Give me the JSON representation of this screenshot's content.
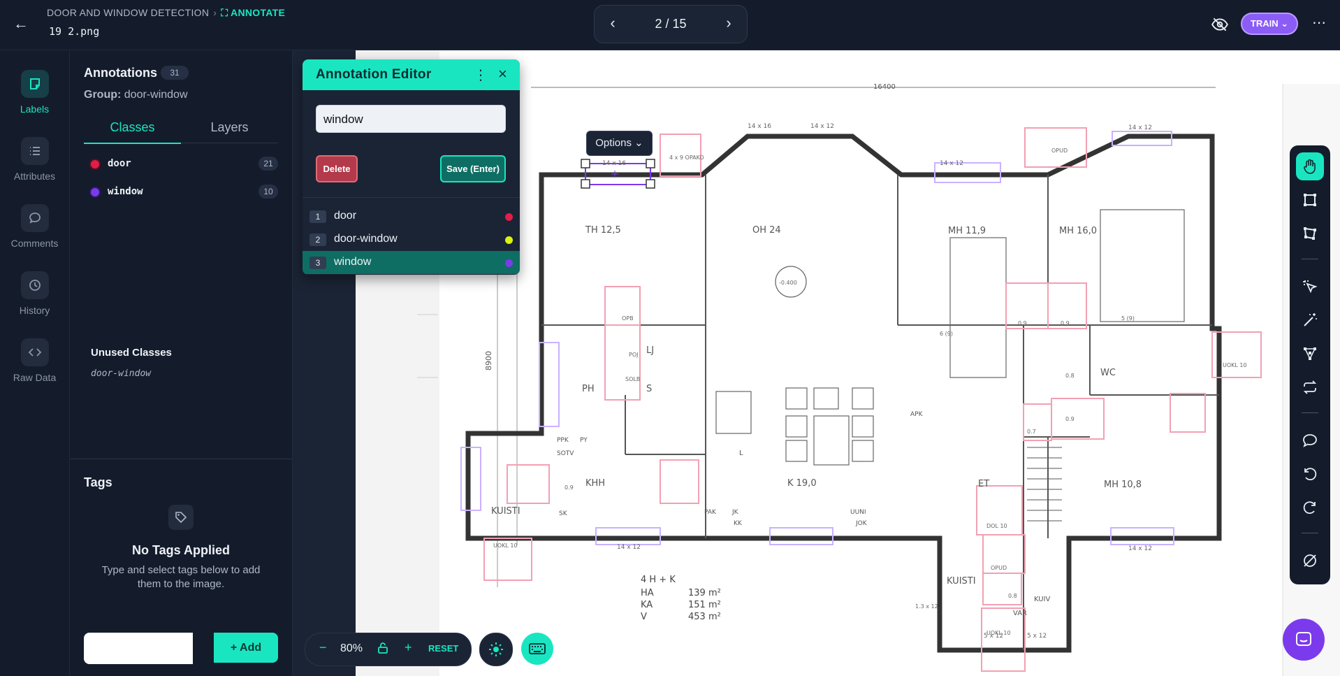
{
  "header": {
    "project": "DOOR AND WINDOW DETECTION",
    "mode": "ANNOTATE",
    "filename": "19 2.png",
    "page_counter": "2 / 15",
    "train_label": "TRAIN"
  },
  "rail": {
    "items": [
      {
        "label": "Labels"
      },
      {
        "label": "Attributes"
      },
      {
        "label": "Comments"
      },
      {
        "label": "History"
      },
      {
        "label": "Raw Data"
      }
    ]
  },
  "panel": {
    "title": "Annotations",
    "count": "31",
    "group_label": "Group:",
    "group_value": "door-window",
    "tabs": [
      "Classes",
      "Layers"
    ],
    "classes": [
      {
        "name": "door",
        "count": "21",
        "color": "#e11d48"
      },
      {
        "name": "window",
        "count": "10",
        "color": "#7c3aed"
      }
    ],
    "unused_title": "Unused Classes",
    "unused_items": [
      "door-window"
    ],
    "tags_title": "Tags",
    "no_tags_title": "No Tags Applied",
    "no_tags_desc": "Type and select tags below to add them to the image.",
    "add_label": "Add"
  },
  "editor": {
    "title": "Annotation Editor",
    "input_value": "window",
    "delete_label": "Delete",
    "save_label": "Save (Enter)",
    "options": [
      {
        "num": "1",
        "label": "door",
        "color": "#e11d48"
      },
      {
        "num": "2",
        "label": "door-window",
        "color": "#d9f20f"
      },
      {
        "num": "3",
        "label": "window",
        "color": "#7c3aed"
      }
    ]
  },
  "canvas": {
    "options_button": "Options",
    "plan_labels": {
      "dimension_top": "16400",
      "dimension_left": "8900",
      "rooms": [
        "TH 12,5",
        "OH 24",
        "MH 11,9",
        "MH 16,0",
        "PH",
        "S",
        "LJ",
        "WC",
        "KHH",
        "K 19,0",
        "ET",
        "MH 10,8",
        "KUISTI",
        "KUISTI",
        "VAR",
        "KUIV",
        "L",
        "SK",
        "PY",
        "PPK",
        "SOTV",
        "APK",
        "UUNI",
        "PAK",
        "JK",
        "KK",
        "JOK"
      ],
      "window_sizes": [
        "14 x 16",
        "14 x 12",
        "14 x 12",
        "14 x 12",
        "14 x 12",
        "14 x 16",
        "14 x 12",
        "5 x 12",
        "5 x 12"
      ],
      "door_marks": [
        "4 x 9 OPAKO",
        "OPUD",
        "OPB",
        "POJ",
        "SOLB",
        "0.9",
        "0.9",
        "0.7",
        "0.9",
        "0.9",
        "0.8",
        "0.8",
        "UOKL 10",
        "UOKL 10",
        "UOKL 10",
        "DOL 10",
        "OPUD",
        "-0.400",
        "6 (9)",
        "5 (9)",
        "1.3 x 12"
      ],
      "areas": [
        {
          "label": "4 H + K",
          "value": ""
        },
        {
          "label": "HA",
          "value": "139 m²"
        },
        {
          "label": "KA",
          "value": "151 m²"
        },
        {
          "label": "V",
          "value": "453 m²"
        }
      ]
    }
  },
  "zoom": {
    "value": "80%",
    "reset_label": "RESET"
  },
  "colors": {
    "accent": "#19e6c1",
    "door": "#e11d48",
    "window": "#7c3aed",
    "door_window": "#d9f20f",
    "train": "#8b5cf6"
  }
}
